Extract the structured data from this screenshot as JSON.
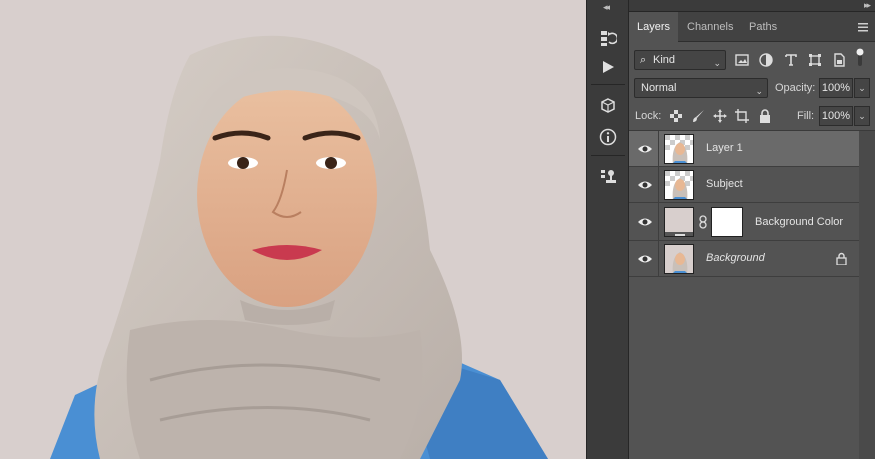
{
  "panel": {
    "tabs": [
      {
        "label": "Layers",
        "active": true
      },
      {
        "label": "Channels",
        "active": false
      },
      {
        "label": "Paths",
        "active": false
      }
    ],
    "filter": {
      "label": "Kind"
    },
    "blend_mode": "Normal",
    "opacity_label": "Opacity:",
    "opacity_value": "100%",
    "lock_label": "Lock:",
    "fill_label": "Fill:",
    "fill_value": "100%"
  },
  "layers": [
    {
      "name": "Layer 1",
      "selected": true,
      "visible": true,
      "thumb": "portrait-transparent"
    },
    {
      "name": "Subject",
      "selected": false,
      "visible": true,
      "thumb": "portrait-transparent"
    },
    {
      "name": "Background Color",
      "selected": false,
      "visible": true,
      "thumb": "color-fill"
    },
    {
      "name": "Background",
      "selected": false,
      "visible": true,
      "thumb": "portrait",
      "italic": true,
      "locked": true
    }
  ],
  "colors": {
    "canvas_bg": "#d8cfcd",
    "panel_bg": "#535353",
    "selected_row": "#6a6a6a",
    "hijab": "#c9c0b9",
    "shirt": "#4a8fd3",
    "skin": "#e8b894"
  },
  "icons": [
    "history-icon",
    "play-icon",
    "3d-cube-icon",
    "info-icon",
    "stamp-icon",
    "search-icon",
    "image-filter-icon",
    "adjustment-filter-icon",
    "type-filter-icon",
    "shape-filter-icon",
    "smartobject-filter-icon",
    "eye-icon",
    "link-icon",
    "lock-icon",
    "brush-icon",
    "move-icon",
    "artboard-icon",
    "checkerboard-icon",
    "panel-menu-icon"
  ]
}
